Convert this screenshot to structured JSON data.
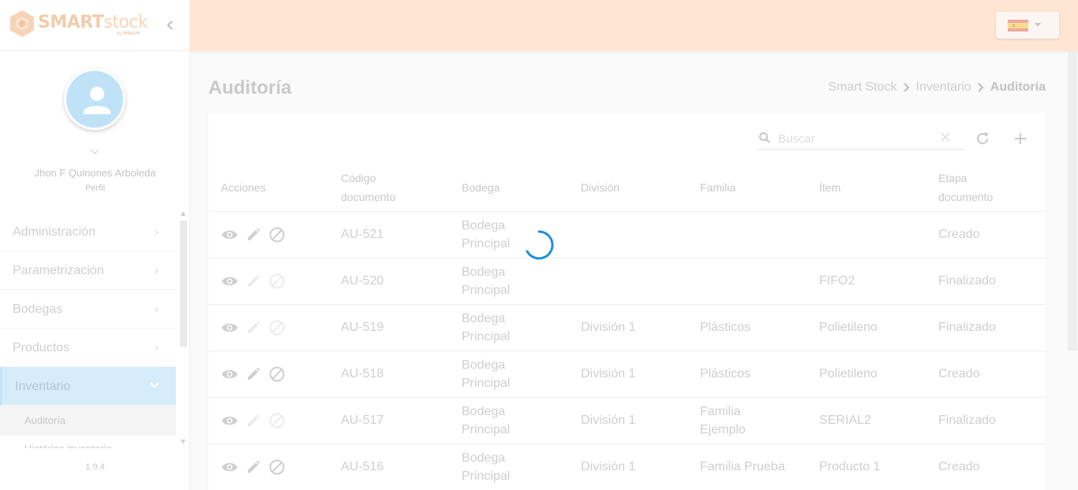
{
  "brand": {
    "name_part1": "SMART",
    "name_part2": "stock",
    "sub": "by PENSUM"
  },
  "user": {
    "name": "Jhon F Quinones Arboleda",
    "role": "Perfil"
  },
  "menu": {
    "items": [
      {
        "label": "Administración"
      },
      {
        "label": "Parametrización"
      },
      {
        "label": "Bodegas"
      },
      {
        "label": "Productos"
      },
      {
        "label": "Inventario"
      }
    ],
    "subitems": [
      {
        "label": "Auditoría"
      },
      {
        "label": "Histórico inventario"
      }
    ]
  },
  "version": "1.9.4",
  "page": {
    "title": "Auditoría",
    "breadcrumb": [
      "Smart Stock",
      "Inventario",
      "Auditoría"
    ]
  },
  "search": {
    "placeholder": "Buscar"
  },
  "table": {
    "headers": {
      "acciones": "Acciones",
      "codigo_1": "Código",
      "codigo_2": "documento",
      "bodega": "Bodega",
      "division": "División",
      "familia": "Familia",
      "item": "Ítem",
      "etapa_1": "Etapa",
      "etapa_2": "documento"
    },
    "rows": [
      {
        "code": "AU-521",
        "bodega_1": "Bodega",
        "bodega_2": "Principal",
        "division": "",
        "familia_1": "",
        "familia_2": "",
        "item": "",
        "etapa": "Creado"
      },
      {
        "code": "AU-520",
        "bodega_1": "Bodega",
        "bodega_2": "Principal",
        "division": "",
        "familia_1": "",
        "familia_2": "",
        "item": "FIFO2",
        "etapa": "Finalizado"
      },
      {
        "code": "AU-519",
        "bodega_1": "Bodega",
        "bodega_2": "Principal",
        "division": "División 1",
        "familia_1": "Plásticos",
        "familia_2": "",
        "item": "Polietileno",
        "etapa": "Finalizado"
      },
      {
        "code": "AU-518",
        "bodega_1": "Bodega",
        "bodega_2": "Principal",
        "division": "División 1",
        "familia_1": "Plásticos",
        "familia_2": "",
        "item": "Polietileno",
        "etapa": "Creado"
      },
      {
        "code": "AU-517",
        "bodega_1": "Bodega",
        "bodega_2": "Principal",
        "division": "División 1",
        "familia_1": "Familia",
        "familia_2": "Ejemplo",
        "item": "SERIAL2",
        "etapa": "Finalizado"
      },
      {
        "code": "AU-516",
        "bodega_1": "Bodega",
        "bodega_2": "Principal",
        "division": "División 1",
        "familia_1": "Familia Prueba",
        "familia_2": "",
        "item": "Producto 1",
        "etapa": "Creado"
      }
    ]
  },
  "colors": {
    "topbar": "#ffe6d3",
    "active_menu": "#d7ecfb",
    "spinner": "#1e90d6"
  },
  "icons": [
    "eye-icon",
    "pencil-icon",
    "ban-icon",
    "search-icon",
    "close-icon",
    "refresh-icon",
    "plus-icon",
    "chevron-right-icon",
    "chevron-down-icon",
    "chevron-left-icon",
    "user-icon",
    "spain-flag-icon"
  ]
}
